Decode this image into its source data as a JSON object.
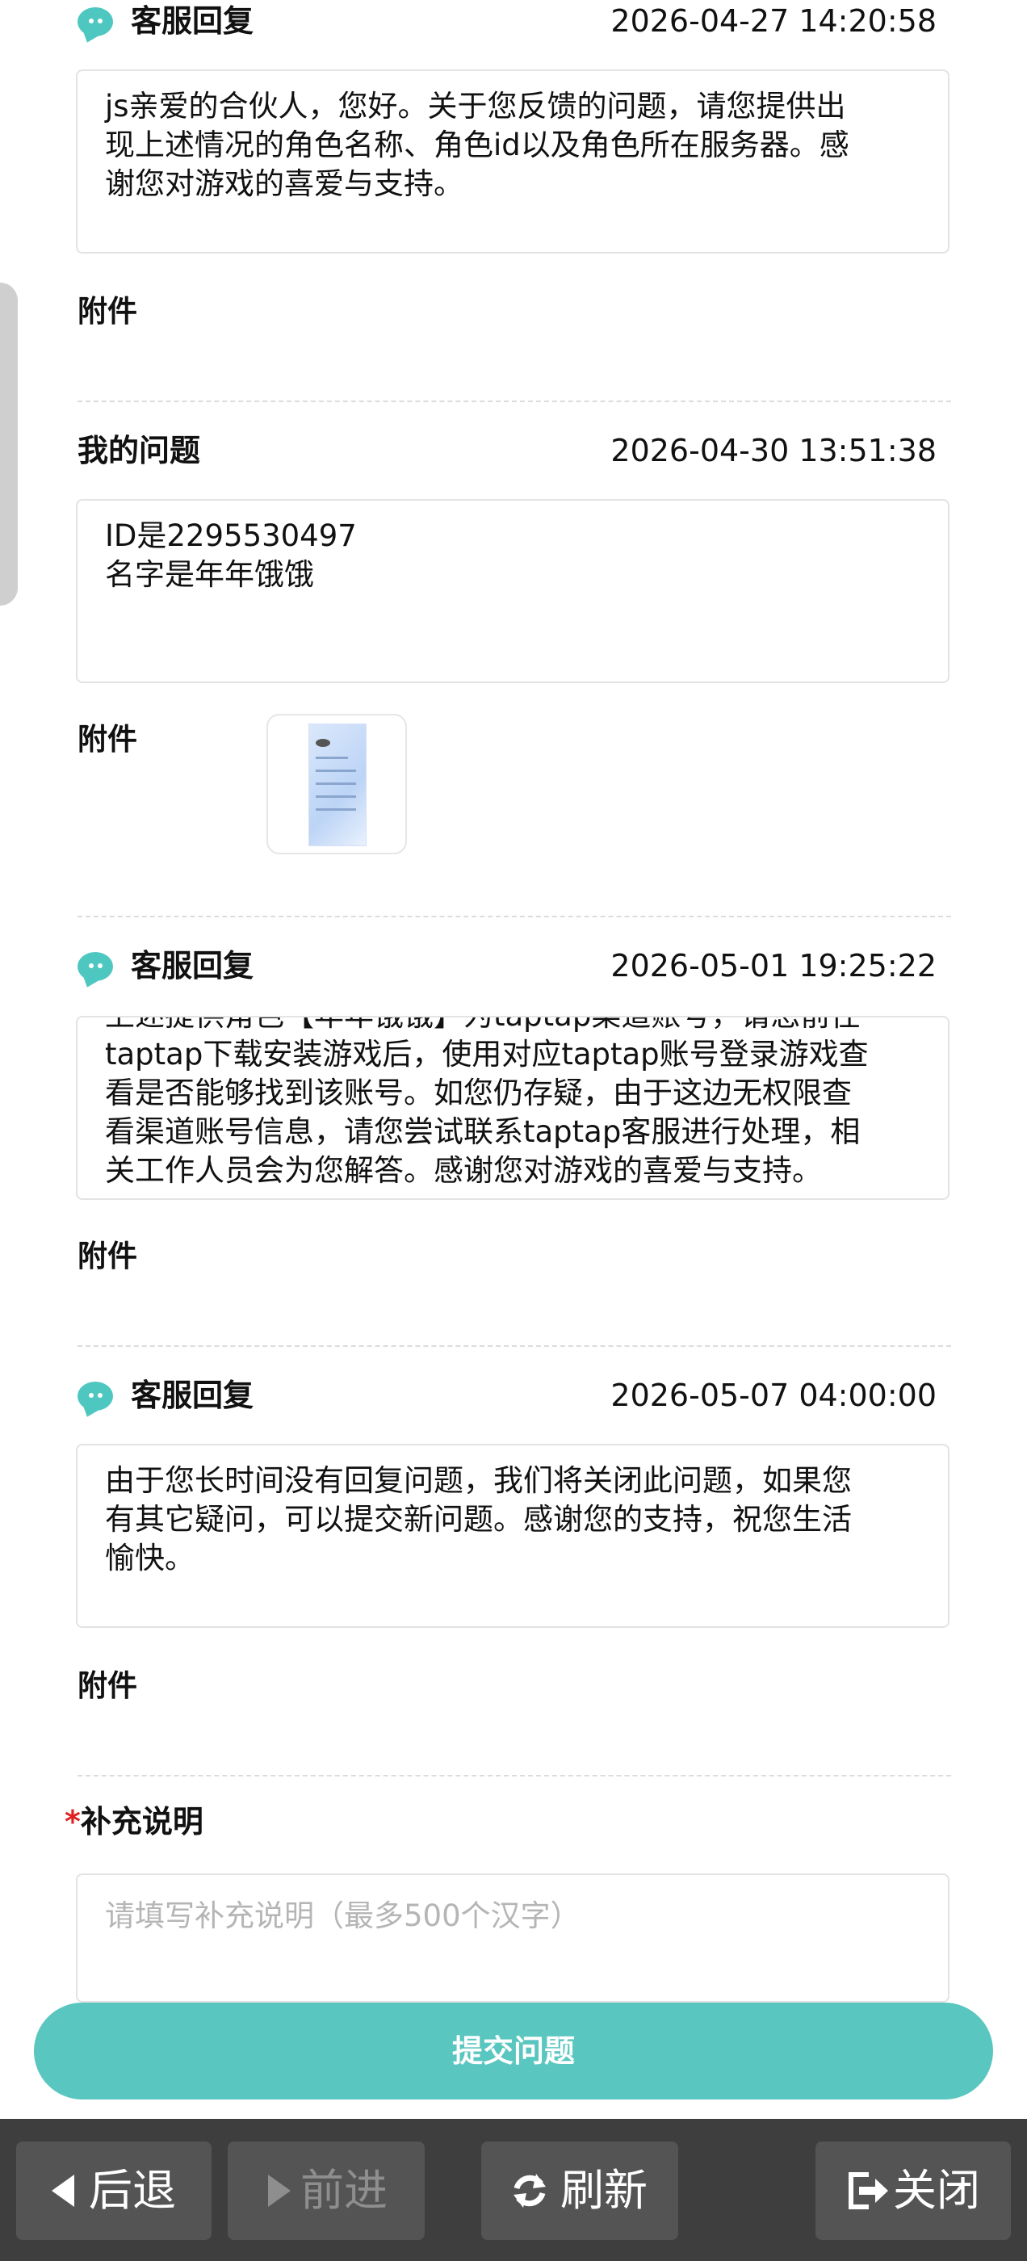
{
  "entries": [
    {
      "title": "客服回复",
      "time": "2026-04-27 14:20:58",
      "content": "js亲爱的合伙人，您好。关于您反馈的问题，请您提供出\n现上述情况的角色名称、角色id以及角色所在服务器。感\n谢您对游戏的喜爱与支持。",
      "attachment_label": "附件"
    },
    {
      "title": "我的问题",
      "time": "2026-04-30 13:51:38",
      "content": "ID是2295530497\n名字是年年饿饿",
      "attachment_label": "附件"
    },
    {
      "title": "客服回复",
      "time": "2026-05-01 19:25:22",
      "content": "上述提供角色【年年饿饿】为taptap渠道账号，请您前往\ntaptap下载安装游戏后，使用对应taptap账号登录游戏查\n看是否能够找到该账号。如您仍存疑，由于这边无权限查\n看渠道账号信息，请您尝试联系taptap客服进行处理，相\n关工作人员会为您解答。感谢您对游戏的喜爱与支持。",
      "attachment_label": "附件"
    },
    {
      "title": "客服回复",
      "time": "2026-05-07 04:00:00",
      "content": "由于您长时间没有回复问题，我们将关闭此问题，如果您\n有其它疑问，可以提交新问题。感谢您的支持，祝您生活\n愉快。",
      "attachment_label": "附件"
    }
  ],
  "supplement": {
    "required_mark": "*",
    "label": "补充说明",
    "placeholder": "请填写补充说明（最多500个汉字）",
    "value": ""
  },
  "submit_label": "提交问题",
  "browser_bar": {
    "back": "后退",
    "forward": "前进",
    "refresh": "刷新",
    "close": "关闭"
  },
  "colors": {
    "accent": "#59c6c0",
    "required": "#e02020",
    "bar": "#3e3e3e"
  }
}
